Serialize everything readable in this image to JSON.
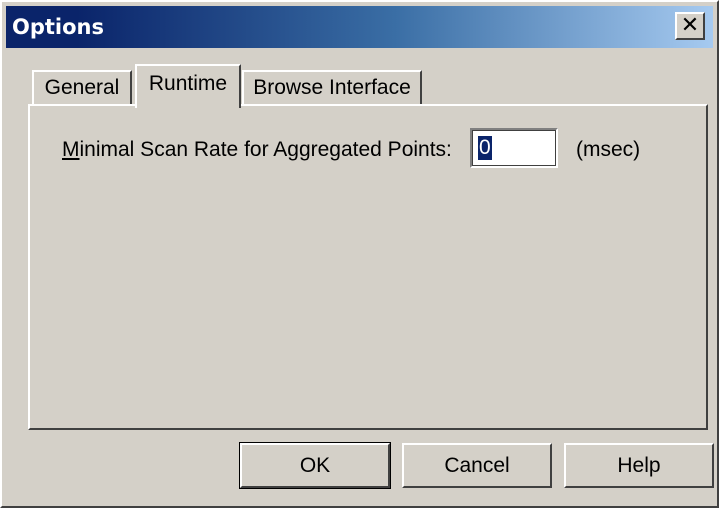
{
  "window": {
    "title": "Options",
    "close_glyph": "✕"
  },
  "tabs": [
    {
      "label": "General",
      "active": false
    },
    {
      "label": "Runtime",
      "active": true
    },
    {
      "label": "Browse Interface",
      "active": false
    }
  ],
  "runtime": {
    "scan_label_accel": "M",
    "scan_label_rest": "inimal Scan Rate for Aggregated Points:",
    "scan_value": "0",
    "unit": "(msec)"
  },
  "buttons": {
    "ok": "OK",
    "cancel": "Cancel",
    "help": "Help"
  },
  "colors": {
    "face": "#d4d0c8",
    "title_start": "#0a246a",
    "title_end": "#a6caf0",
    "selection": "#0a246a"
  },
  "icons": {
    "close": "close-icon"
  }
}
